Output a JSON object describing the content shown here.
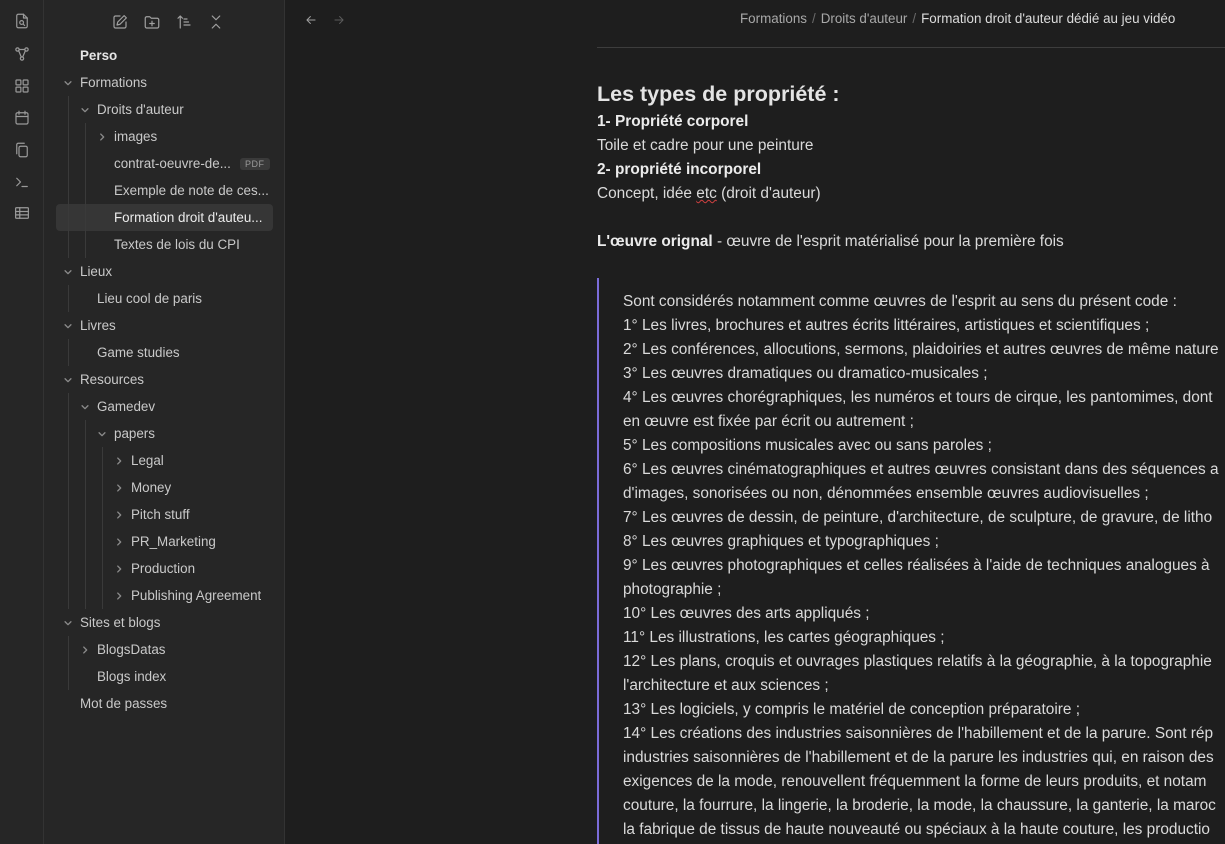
{
  "ribbon": {
    "icons": [
      "file-search-icon",
      "graph-icon",
      "grid-icon",
      "calendar-icon",
      "copy-icon",
      "terminal-icon",
      "table-icon"
    ]
  },
  "sidebar": {
    "toolbar": [
      "new-note-icon",
      "new-folder-icon",
      "sort-icon",
      "collapse-icon"
    ],
    "vault": "Perso",
    "tree": [
      {
        "label": "Formations",
        "depth": 0,
        "folder": true,
        "open": true
      },
      {
        "label": "Droits d'auteur",
        "depth": 1,
        "folder": true,
        "open": true
      },
      {
        "label": "images",
        "depth": 2,
        "folder": true,
        "open": false
      },
      {
        "label": "contrat-oeuvre-de...",
        "depth": 2,
        "folder": false,
        "badge": "PDF"
      },
      {
        "label": "Exemple de note de ces...",
        "depth": 2,
        "folder": false
      },
      {
        "label": "Formation droit d'auteu...",
        "depth": 2,
        "folder": false,
        "active": true
      },
      {
        "label": "Textes de lois du CPI",
        "depth": 2,
        "folder": false
      },
      {
        "label": "Lieux",
        "depth": 0,
        "folder": true,
        "open": true
      },
      {
        "label": "Lieu cool de paris",
        "depth": 1,
        "folder": false
      },
      {
        "label": "Livres",
        "depth": 0,
        "folder": true,
        "open": true
      },
      {
        "label": "Game studies",
        "depth": 1,
        "folder": false
      },
      {
        "label": "Resources",
        "depth": 0,
        "folder": true,
        "open": true
      },
      {
        "label": "Gamedev",
        "depth": 1,
        "folder": true,
        "open": true
      },
      {
        "label": "papers",
        "depth": 2,
        "folder": true,
        "open": true
      },
      {
        "label": "Legal",
        "depth": 3,
        "folder": true,
        "open": false
      },
      {
        "label": "Money",
        "depth": 3,
        "folder": true,
        "open": false
      },
      {
        "label": "Pitch stuff",
        "depth": 3,
        "folder": true,
        "open": false
      },
      {
        "label": "PR_Marketing",
        "depth": 3,
        "folder": true,
        "open": false
      },
      {
        "label": "Production",
        "depth": 3,
        "folder": true,
        "open": false
      },
      {
        "label": "Publishing Agreement",
        "depth": 3,
        "folder": true,
        "open": false
      },
      {
        "label": "Sites et blogs",
        "depth": 0,
        "folder": true,
        "open": true
      },
      {
        "label": "BlogsDatas",
        "depth": 1,
        "folder": true,
        "open": false
      },
      {
        "label": "Blogs index",
        "depth": 1,
        "folder": false
      },
      {
        "label": "Mot de passes",
        "depth": 0,
        "folder": false
      }
    ]
  },
  "header": {
    "breadcrumb": [
      "Formations",
      "Droits d'auteur"
    ],
    "current": "Formation droit d'auteur dédié au jeu vidéo"
  },
  "note": {
    "heading": "Les types de propriété :",
    "p1_bold": "1- Propriété corporel",
    "p1_text": "Toile et cadre pour une peinture",
    "p2_bold": "2- propriété incorporel",
    "p2_text_a": "Concept, idée ",
    "p2_text_spell": "etc",
    "p2_text_b": " (droit d'auteur)",
    "oeuvre_bold": "L'œuvre orignal",
    "oeuvre_text": " - œuvre de l'esprit matérialisé pour la première fois",
    "quote": [
      "Sont considérés notamment comme œuvres de l'esprit au sens du présent code :",
      "1° Les livres, brochures et autres écrits littéraires, artistiques et scientifiques ;",
      "2° Les conférences, allocutions, sermons, plaidoiries et autres œuvres de même nature",
      "3° Les œuvres dramatiques ou dramatico-musicales ;",
      "4° Les œuvres chorégraphiques, les numéros et tours de cirque, les pantomimes, dont",
      "en œuvre est fixée par écrit ou autrement ;",
      "5° Les compositions musicales avec ou sans paroles ;",
      "6° Les œuvres cinématographiques et autres œuvres consistant dans des séquences a",
      "d'images, sonorisées ou non, dénommées ensemble œuvres audiovisuelles ;",
      "7° Les œuvres de dessin, de peinture, d'architecture, de sculpture, de gravure, de litho",
      "8° Les œuvres graphiques et typographiques ;",
      "9° Les œuvres photographiques et celles réalisées à l'aide de techniques analogues à",
      "photographie ;",
      "10° Les œuvres des arts appliqués ;",
      "11° Les illustrations, les cartes géographiques ;",
      "12° Les plans, croquis et ouvrages plastiques relatifs à la géographie, à la topographie",
      "l'architecture et aux sciences ;",
      "13° Les logiciels, y compris le matériel de conception préparatoire ;",
      "14° Les créations des industries saisonnières de l'habillement et de la parure. Sont rép",
      "industries saisonnières de l'habillement et de la parure les industries qui, en raison des",
      "exigences de la mode, renouvellent fréquemment la forme de leurs produits, et notam",
      "couture, la fourrure, la lingerie, la broderie, la mode, la chaussure, la ganterie, la maroc",
      "la fabrique de tissus de haute nouveauté ou spéciaux à la haute couture, les productio"
    ]
  },
  "colors": {
    "accent": "#7b6cd9",
    "background": "#1e1e1e",
    "sidebar": "#262626"
  }
}
